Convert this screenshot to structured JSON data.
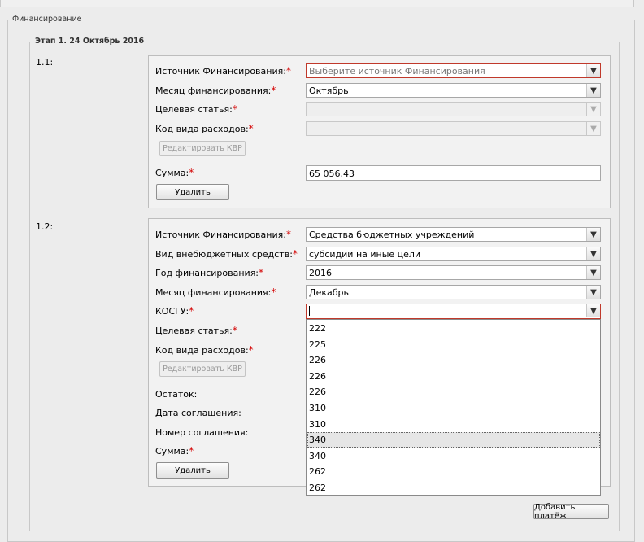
{
  "section_title": "Финансирование",
  "stage_title": "Этап 1. 24 Октябрь 2016",
  "block1": {
    "number": "1.1:",
    "source_label": "Источник Финансирования:",
    "source_placeholder": "Выберите источник Финансирования",
    "month_label": "Месяц финансирования:",
    "month_value": "Октябрь",
    "article_label": "Целевая статья:",
    "expense_label": "Код вида расходов:",
    "edit_kvr": "Редактировать КВР",
    "sum_label": "Сумма:",
    "sum_value": "65 056,43",
    "delete": "Удалить"
  },
  "block2": {
    "number": "1.2:",
    "source_label": "Источник Финансирования:",
    "source_value": "Средства бюджетных учреждений",
    "offbudget_label": "Вид внебюджетных средств:",
    "offbudget_value": "субсидии на иные цели",
    "year_label": "Год финансирования:",
    "year_value": "2016",
    "month_label": "Месяц финансирования:",
    "month_value": "Декабрь",
    "kosgu_label": "КОСГУ:",
    "article_label": "Целевая статья:",
    "expense_label": "Код вида расходов:",
    "edit_kvr": "Редактировать КВР",
    "balance_label": "Остаток:",
    "agreement_date_label": "Дата соглашения:",
    "agreement_number_label": "Номер соглашения:",
    "sum_label": "Сумма:",
    "delete": "Удалить"
  },
  "required_mark": "*",
  "kosgu_options": [
    "222",
    "225",
    "226",
    "226",
    "226",
    "310",
    "310",
    "340",
    "340",
    "262",
    "262"
  ],
  "kosgu_highlighted_index": 7,
  "add_payment": "Добавить платёж",
  "icons": {
    "dropdown": "chevron-down-icon"
  },
  "colors": {
    "required": "#d40000",
    "error_border": "#c0392b"
  }
}
